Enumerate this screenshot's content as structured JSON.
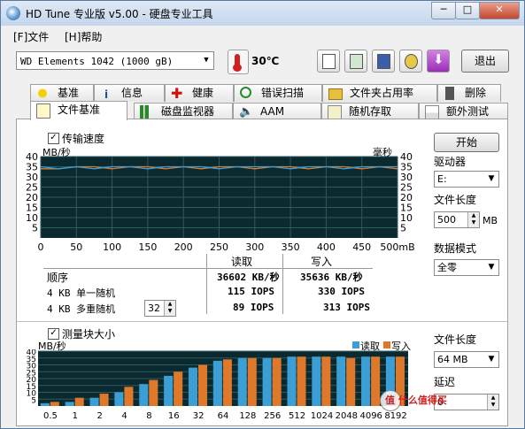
{
  "window": {
    "title": "HD Tune 专业版 v5.00 - 硬盘专业工具",
    "controls": {
      "minimize": "─",
      "maximize": "□",
      "close": "✕"
    }
  },
  "menu": {
    "file": "[F]文件",
    "help": "[H]帮助"
  },
  "toolbar": {
    "drive": "WD     Elements 1042     (1000 gB)",
    "temperature": "30℃",
    "exit_label": "退出",
    "icons": [
      "copy-text-icon",
      "copy-image-icon",
      "save-icon",
      "options-icon",
      "download-icon"
    ]
  },
  "tabs_top": [
    {
      "label": "基准",
      "icon": "benchmark-icon"
    },
    {
      "label": "信息",
      "icon": "info-icon"
    },
    {
      "label": "健康",
      "icon": "health-icon"
    },
    {
      "label": "错误扫描",
      "icon": "error-scan-icon"
    },
    {
      "label": "文件夹占用率",
      "icon": "folder-usage-icon"
    },
    {
      "label": "删除",
      "icon": "erase-icon"
    }
  ],
  "tabs_bottom": [
    {
      "label": "文件基准",
      "icon": "file-benchmark-icon",
      "active": true
    },
    {
      "label": "磁盘监视器",
      "icon": "disk-monitor-icon"
    },
    {
      "label": "AAM",
      "icon": "aam-icon"
    },
    {
      "label": "随机存取",
      "icon": "random-access-icon"
    },
    {
      "label": "额外测试",
      "icon": "extra-tests-icon"
    }
  ],
  "transfer": {
    "checkbox_label": "传输速度",
    "checked": "✓",
    "left_unit": "MB/秒",
    "right_unit": "毫秒"
  },
  "results": {
    "header_read": "读取",
    "header_write": "写入",
    "rows": [
      {
        "label": "顺序",
        "read": "36602 KB/秒",
        "write": "35636 KB/秒"
      },
      {
        "label": "4 KB 单一随机",
        "read": "115 IOPS",
        "write": "330 IOPS"
      },
      {
        "label": "4 KB 多重随机",
        "queue": "32",
        "read": "89 IOPS",
        "write": "313 IOPS"
      }
    ]
  },
  "blocksize": {
    "checkbox_label": "测量块大小",
    "checked": "✓",
    "unit": "MB/秒",
    "legend_read": "读取",
    "legend_write": "写入"
  },
  "side": {
    "start_label": "开始",
    "drive_label": "驱动器",
    "drive_value": "E:",
    "filesize_label": "文件长度",
    "filesize_value": "500",
    "filesize_unit": "MB",
    "mode_label": "数据模式",
    "mode_value": "全零",
    "file_length_label": "文件长度",
    "file_length_value": "64 MB",
    "delay_label": "延迟",
    "delay_value": "0"
  },
  "watermark": "值 什么值得买",
  "colors": {
    "read": "#3b9fd6",
    "write": "#e0782a",
    "chart_bg": "#0a2a30",
    "grid": "#2e5a60"
  },
  "chart_data": [
    {
      "type": "line",
      "x": [
        0,
        25,
        50,
        75,
        100,
        125,
        150,
        175,
        200,
        225,
        250,
        275,
        300,
        325,
        350,
        375,
        400,
        425,
        450,
        475,
        500
      ],
      "xlim": [
        0,
        500
      ],
      "ylim": [
        0,
        40
      ],
      "y2lim": [
        0,
        40
      ],
      "x_ticks": [
        "0",
        "50",
        "100",
        "150",
        "200",
        "250",
        "300",
        "350",
        "400",
        "450",
        "500mB"
      ],
      "y_ticks": [
        "40",
        "35",
        "30",
        "25",
        "20",
        "15",
        "10",
        "5"
      ],
      "y2_ticks": [
        "40",
        "35",
        "30",
        "25",
        "20",
        "15",
        "10",
        "5"
      ],
      "series": [
        {
          "name": "读取",
          "values": [
            35,
            34,
            35,
            34,
            35,
            35,
            34,
            35,
            35,
            35,
            34,
            35,
            35,
            35,
            34,
            35,
            35,
            34,
            35,
            35,
            35
          ]
        },
        {
          "name": "写入",
          "values": [
            34,
            34,
            35,
            35,
            34,
            35,
            35,
            34,
            35,
            34,
            35,
            35,
            34,
            35,
            35,
            34,
            35,
            35,
            34,
            35,
            34
          ]
        }
      ]
    },
    {
      "type": "bar",
      "categories": [
        "0.5",
        "1",
        "2",
        "4",
        "8",
        "16",
        "32",
        "64",
        "128",
        "256",
        "512",
        "1024",
        "2048",
        "4096",
        "8192"
      ],
      "x_ticks": [
        "0.5",
        "1",
        "2",
        "4",
        "8",
        "16",
        "32",
        "64",
        "128",
        "256",
        "512",
        "1024",
        "2048",
        "4096",
        "8192"
      ],
      "ylim": [
        0,
        40
      ],
      "y_ticks": [
        "40",
        "35",
        "30",
        "25",
        "20",
        "15",
        "10",
        "5"
      ],
      "series": [
        {
          "name": "读取",
          "values": [
            2,
            3,
            6,
            10,
            16,
            22,
            28,
            33,
            35,
            35,
            36,
            36,
            36,
            36,
            36
          ]
        },
        {
          "name": "写入",
          "values": [
            3,
            6,
            9,
            14,
            19,
            25,
            30,
            34,
            35,
            35,
            36,
            36,
            35,
            36,
            36
          ]
        }
      ]
    }
  ]
}
